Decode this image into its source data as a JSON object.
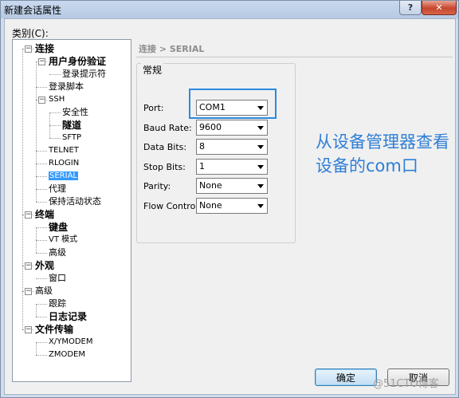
{
  "window": {
    "title": "新建会话属性",
    "help_label": "?",
    "close_label": "✕"
  },
  "category_label": "类别(C):",
  "tree": [
    {
      "label": "连接",
      "level": 0,
      "expanded": true,
      "bold": true
    },
    {
      "label": "用户身份验证",
      "level": 1,
      "expanded": true,
      "bold": true
    },
    {
      "label": "登录提示符",
      "level": 2
    },
    {
      "label": "登录脚本",
      "level": 1
    },
    {
      "label": "SSH",
      "level": 1,
      "expanded": true
    },
    {
      "label": "安全性",
      "level": 2
    },
    {
      "label": "隧道",
      "level": 2,
      "bold": true
    },
    {
      "label": "SFTP",
      "level": 2
    },
    {
      "label": "TELNET",
      "level": 1
    },
    {
      "label": "RLOGIN",
      "level": 1
    },
    {
      "label": "SERIAL",
      "level": 1,
      "selected": true
    },
    {
      "label": "代理",
      "level": 1
    },
    {
      "label": "保持活动状态",
      "level": 1
    },
    {
      "label": "终端",
      "level": 0,
      "expanded": true,
      "bold": true
    },
    {
      "label": "键盘",
      "level": 1,
      "bold": true
    },
    {
      "label": "VT 模式",
      "level": 1
    },
    {
      "label": "高级",
      "level": 1
    },
    {
      "label": "外观",
      "level": 0,
      "expanded": true,
      "bold": true
    },
    {
      "label": "窗口",
      "level": 1
    },
    {
      "label": "高级",
      "level": 0,
      "expanded": true
    },
    {
      "label": "跟踪",
      "level": 1
    },
    {
      "label": "日志记录",
      "level": 1,
      "bold": true
    },
    {
      "label": "文件传输",
      "level": 0,
      "expanded": true,
      "bold": true
    },
    {
      "label": "X/YMODEM",
      "level": 1
    },
    {
      "label": "ZMODEM",
      "level": 1
    }
  ],
  "breadcrumb": "连接 > SERIAL",
  "group": {
    "title": "常规",
    "fields": [
      {
        "label": "Port:",
        "value": "COM1"
      },
      {
        "label": "Baud Rate:",
        "value": "9600"
      },
      {
        "label": "Data Bits:",
        "value": "8"
      },
      {
        "label": "Stop Bits:",
        "value": "1"
      },
      {
        "label": "Parity:",
        "value": "None"
      },
      {
        "label": "Flow Control:",
        "value": "None"
      }
    ]
  },
  "annotation": "从设备管理器查看设备的com口",
  "buttons": {
    "ok": "确定",
    "cancel": "取消"
  },
  "watermark": "@51CTO博客",
  "colors": {
    "annotation": "#2f7fd6",
    "highlight_border": "#2b8ae0",
    "selected_bg": "#3399ff"
  }
}
